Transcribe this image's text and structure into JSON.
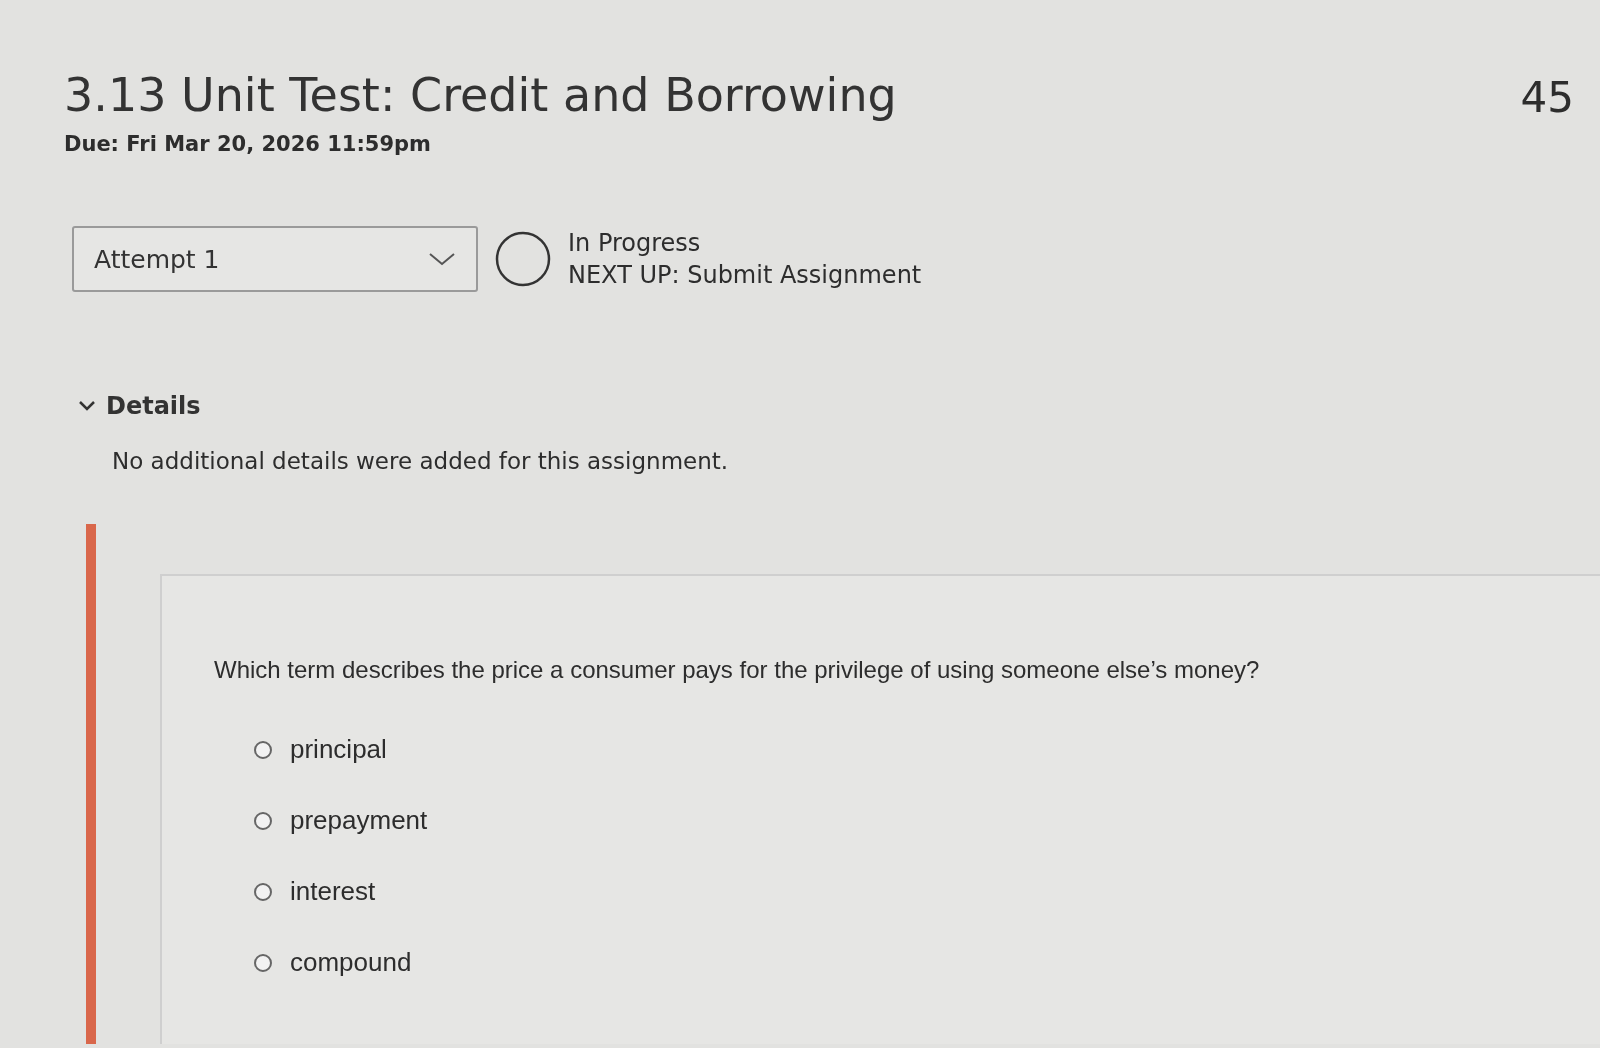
{
  "header": {
    "title": "3.13 Unit Test: Credit and Borrowing",
    "points": "45",
    "due": "Due: Fri Mar 20, 2026 11:59pm"
  },
  "attempt": {
    "value": "Attempt 1"
  },
  "status": {
    "state": "In Progress",
    "next": "NEXT UP: Submit Assignment"
  },
  "details": {
    "label": "Details",
    "expanded": true,
    "text": "No additional details were added for this assignment."
  },
  "question": {
    "text": "Which term describes the price a consumer pays for the privilege of using someone else’s money?",
    "options": [
      {
        "label": "principal",
        "selected": false
      },
      {
        "label": "prepayment",
        "selected": false
      },
      {
        "label": "interest",
        "selected": false
      },
      {
        "label": "compound",
        "selected": false
      }
    ]
  }
}
